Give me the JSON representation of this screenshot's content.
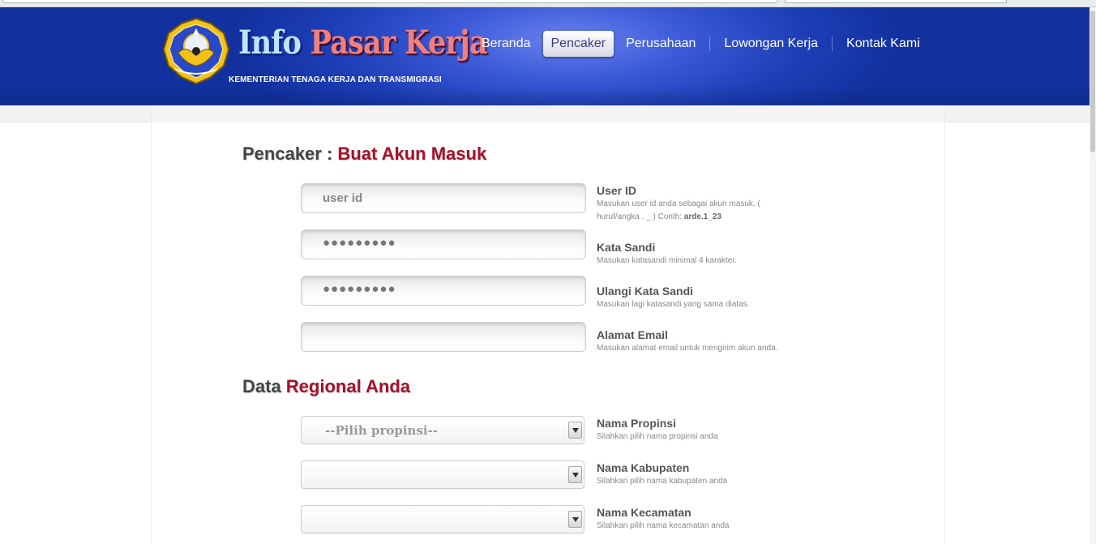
{
  "brand": {
    "title_part1": "Info",
    "title_part2": "Pasar Kerja",
    "subtitle": "KEMENTERIAN TENAGA KERJA DAN TRANSMIGRASI",
    "emblem_icon": "ministry-emblem-icon"
  },
  "nav": {
    "items": [
      {
        "label": "Beranda",
        "active": false
      },
      {
        "label": "Pencaker",
        "active": true
      },
      {
        "label": "Perusahaan",
        "active": false
      },
      {
        "label": "Lowongan Kerja",
        "active": false
      },
      {
        "label": "Kontak Kami",
        "active": false
      }
    ]
  },
  "account_section": {
    "title_prefix": "Pencaker : ",
    "title_highlight": "Buat Akun Masuk",
    "fields": [
      {
        "label": "User ID",
        "hint_line1": "Masukan user id anda sebagai akun masuk. (",
        "hint_line2": "huruf/angka . _ ) Conth: ",
        "hint_example": "arde.1_23",
        "value": "user id"
      },
      {
        "label": "Kata Sandi",
        "hint_line1": "Masukan katasandi minimal 4 karakter.",
        "value": "●●●●●●●●●"
      },
      {
        "label": "Ulangi Kata Sandi",
        "hint_line1": "Masukan lagi katasandi yang sama diatas.",
        "value": "●●●●●●●●●"
      },
      {
        "label": "Alamat Email",
        "hint_line1": "Masukan alamat email untuk mengirim akun anda.",
        "value": ""
      }
    ]
  },
  "regional_section": {
    "title_prefix": "Data ",
    "title_highlight": "Regional Anda",
    "selects": [
      {
        "label": "Nama Propinsi",
        "hint": "Silahkan pilih nama propinsi anda",
        "value": "--Pilih propinsi--"
      },
      {
        "label": "Nama Kabupaten",
        "hint": "Silahkan pilih nama kabupaten anda",
        "value": ""
      },
      {
        "label": "Nama Kecamatan",
        "hint": "Silahkan pilih nama kecamatan anda",
        "value": ""
      }
    ]
  },
  "colors": {
    "header_blue": "#1d3eb6",
    "accent_red": "#a4122a",
    "title_gray": "#444444"
  }
}
